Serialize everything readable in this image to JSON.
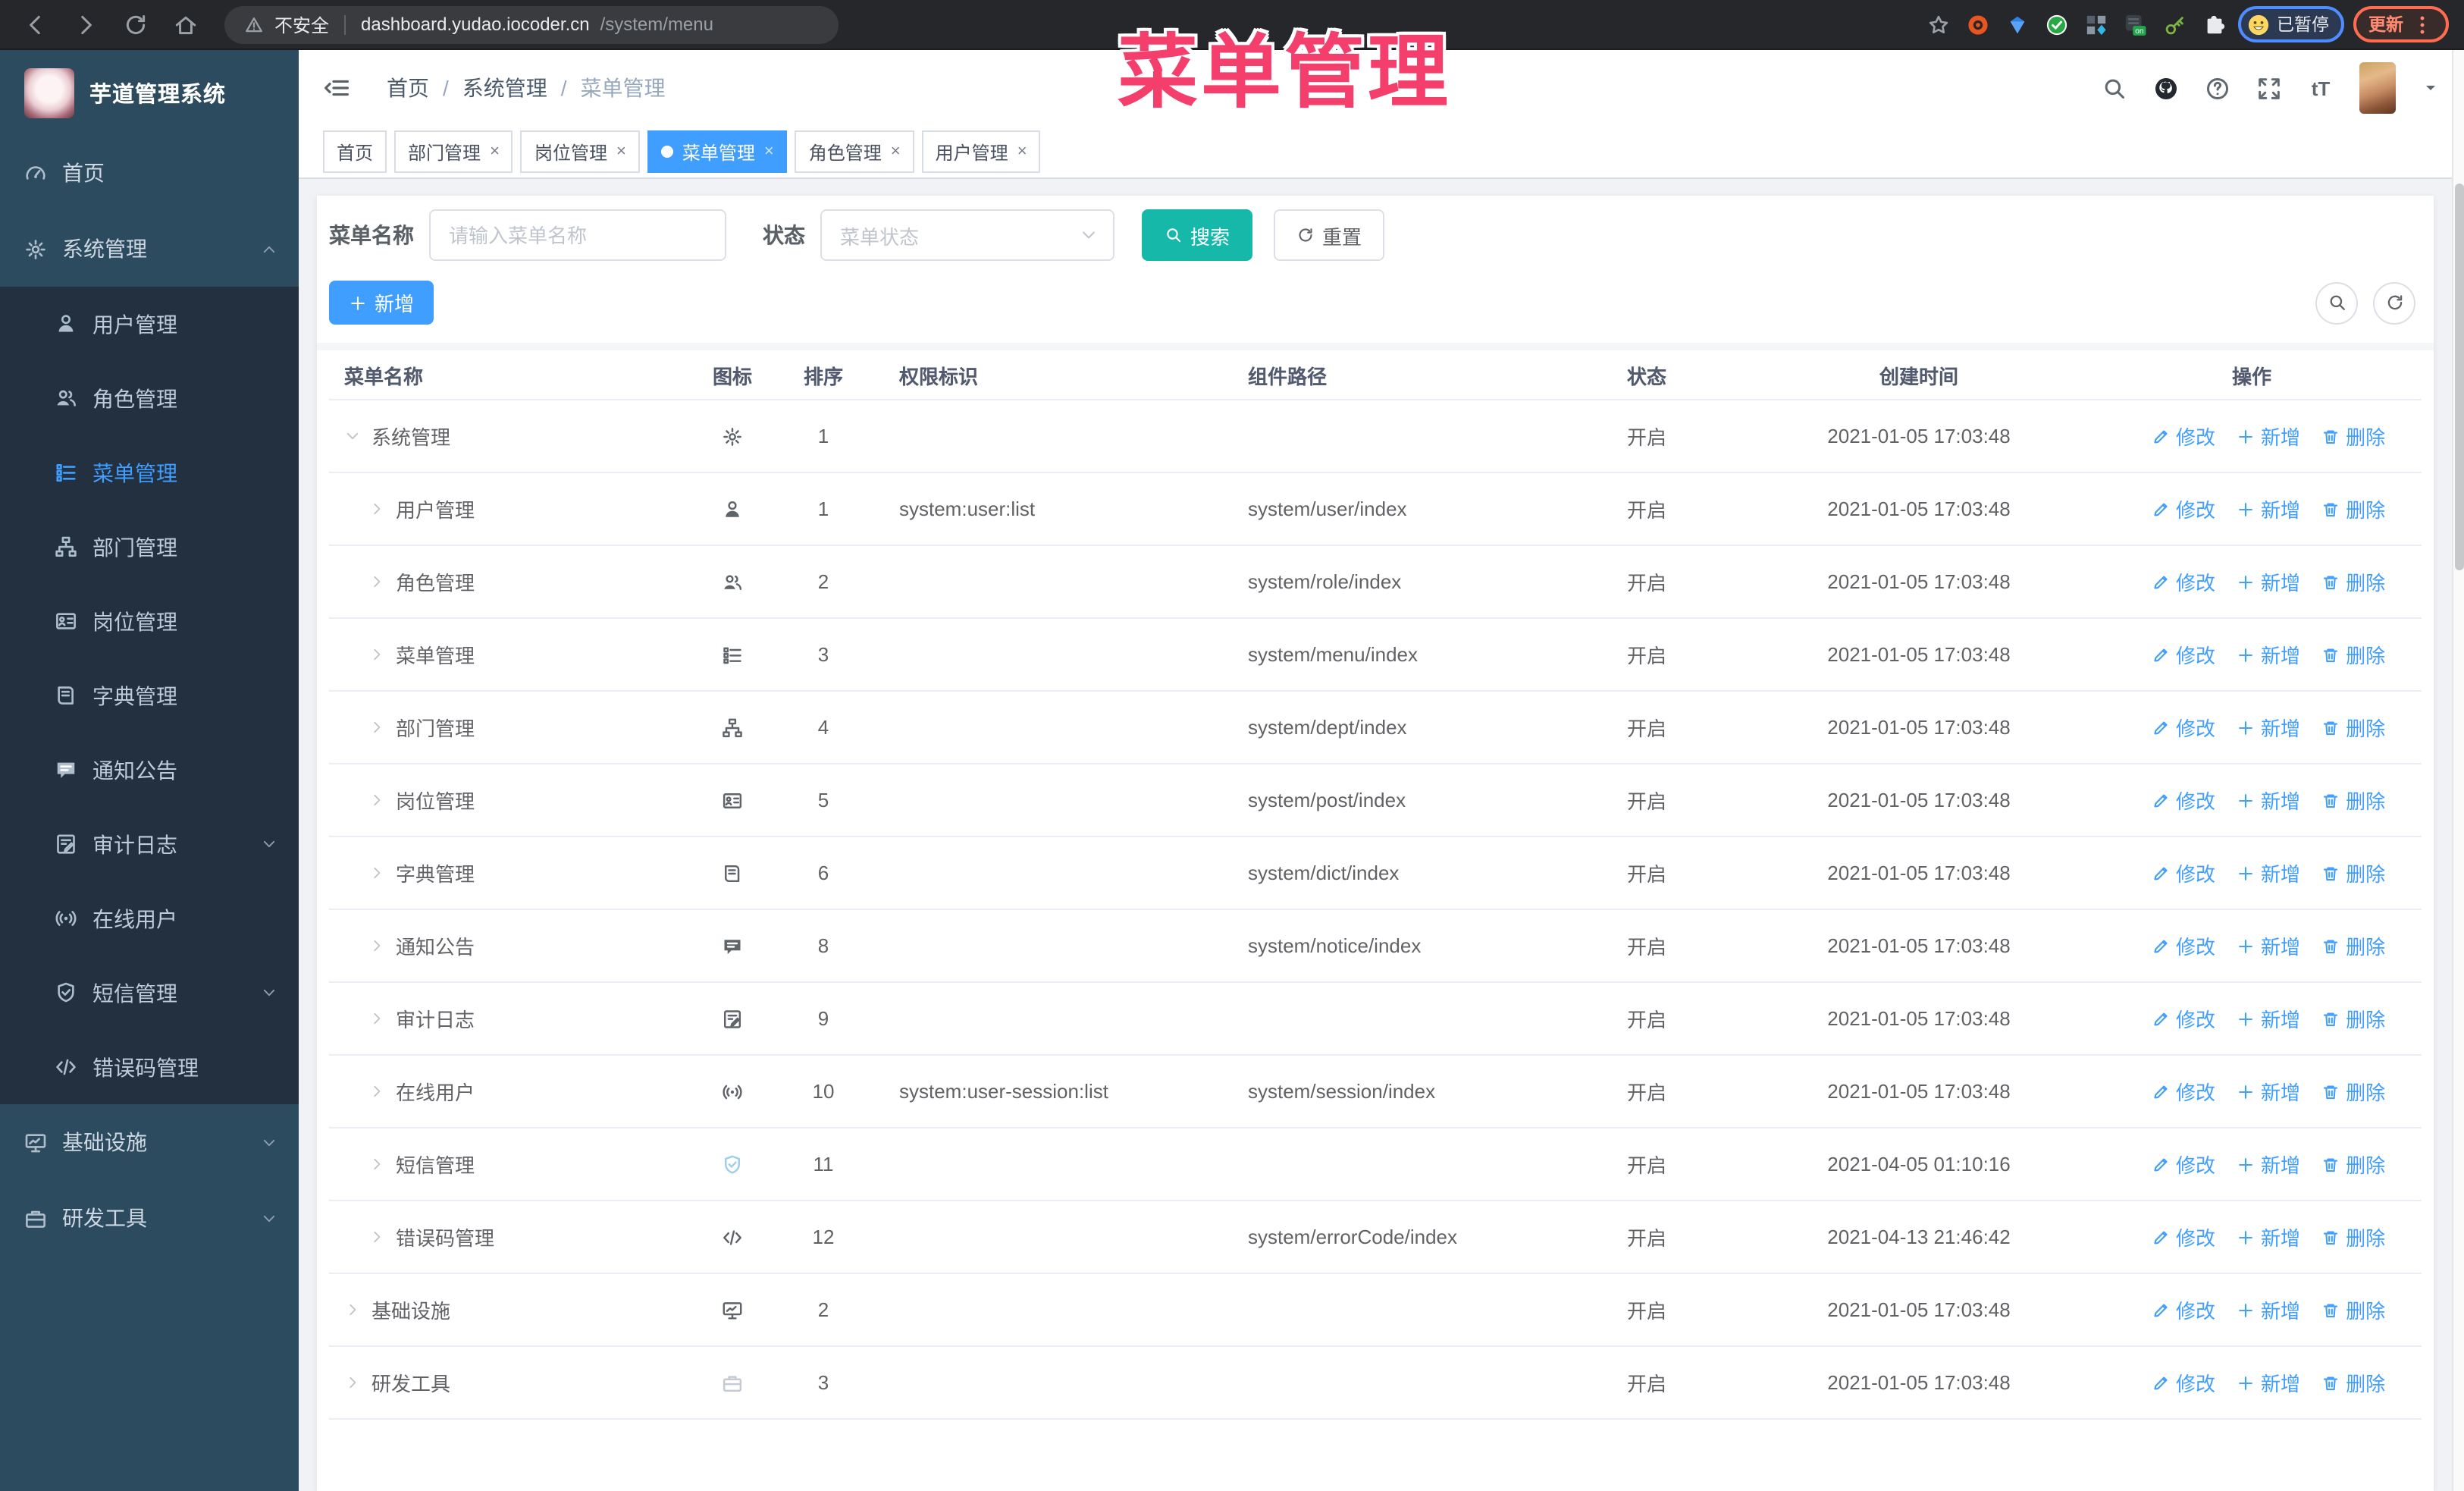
{
  "browser": {
    "security_label": "不安全",
    "url_host": "dashboard.yudao.iocoder.cn",
    "url_path": "/system/menu",
    "paused_label": "已暂停",
    "update_label": "更新",
    "extension_icons": [
      "ubuntu-circle-icon",
      "gem-icon",
      "check-shield-icon",
      "grid-diamond-icon",
      "on-badge-icon",
      "key-icon",
      "puzzle-icon"
    ]
  },
  "overlay_title": "菜单管理",
  "app_header": {
    "breadcrumb": [
      "首页",
      "系统管理",
      "菜单管理"
    ]
  },
  "sidebar": {
    "app_title": "芋道管理系统",
    "items": [
      {
        "label": "首页",
        "icon": "dashboard-icon",
        "level": 0
      },
      {
        "label": "系统管理",
        "icon": "gear-icon",
        "level": 0,
        "arrow": "up"
      },
      {
        "label": "用户管理",
        "icon": "user-icon",
        "level": 1
      },
      {
        "label": "角色管理",
        "icon": "users-icon",
        "level": 1
      },
      {
        "label": "菜单管理",
        "icon": "menu-list-icon",
        "level": 1,
        "active": true
      },
      {
        "label": "部门管理",
        "icon": "org-tree-icon",
        "level": 1
      },
      {
        "label": "岗位管理",
        "icon": "badge-icon",
        "level": 1
      },
      {
        "label": "字典管理",
        "icon": "dict-icon",
        "level": 1
      },
      {
        "label": "通知公告",
        "icon": "notice-icon",
        "level": 1
      },
      {
        "label": "审计日志",
        "icon": "log-icon",
        "level": 1,
        "arrow": "down"
      },
      {
        "label": "在线用户",
        "icon": "online-icon",
        "level": 1
      },
      {
        "label": "短信管理",
        "icon": "sms-shield-icon",
        "level": 1,
        "arrow": "down"
      },
      {
        "label": "错误码管理",
        "icon": "code-icon",
        "level": 1
      },
      {
        "label": "基础设施",
        "icon": "infra-icon",
        "level": 0,
        "arrow": "down"
      },
      {
        "label": "研发工具",
        "icon": "tool-icon",
        "level": 0,
        "arrow": "down"
      }
    ]
  },
  "tabs": [
    {
      "label": "首页",
      "closable": false,
      "active": false
    },
    {
      "label": "部门管理",
      "closable": true,
      "active": false
    },
    {
      "label": "岗位管理",
      "closable": true,
      "active": false
    },
    {
      "label": "菜单管理",
      "closable": true,
      "active": true
    },
    {
      "label": "角色管理",
      "closable": true,
      "active": false
    },
    {
      "label": "用户管理",
      "closable": true,
      "active": false
    }
  ],
  "search": {
    "name_label": "菜单名称",
    "name_placeholder": "请输入菜单名称",
    "status_label": "状态",
    "status_placeholder": "菜单状态",
    "search_label": "搜索",
    "reset_label": "重置"
  },
  "toolbar": {
    "add_label": "新增"
  },
  "table": {
    "columns": [
      "菜单名称",
      "图标",
      "排序",
      "权限标识",
      "组件路径",
      "状态",
      "创建时间",
      "操作"
    ],
    "actions": {
      "edit": "修改",
      "add": "新增",
      "delete": "删除"
    },
    "rows": [
      {
        "name": "系统管理",
        "icon": "gear-icon",
        "level": 0,
        "expanded": true,
        "sort": "1",
        "perm": "",
        "path": "",
        "status": "开启",
        "time": "2021-01-05 17:03:48"
      },
      {
        "name": "用户管理",
        "icon": "user-icon",
        "level": 1,
        "sort": "1",
        "perm": "system:user:list",
        "path": "system/user/index",
        "status": "开启",
        "time": "2021-01-05 17:03:48"
      },
      {
        "name": "角色管理",
        "icon": "users-icon",
        "level": 1,
        "sort": "2",
        "perm": "",
        "path": "system/role/index",
        "status": "开启",
        "time": "2021-01-05 17:03:48"
      },
      {
        "name": "菜单管理",
        "icon": "menu-list-icon",
        "level": 1,
        "sort": "3",
        "perm": "",
        "path": "system/menu/index",
        "status": "开启",
        "time": "2021-01-05 17:03:48"
      },
      {
        "name": "部门管理",
        "icon": "org-tree-icon",
        "level": 1,
        "sort": "4",
        "perm": "",
        "path": "system/dept/index",
        "status": "开启",
        "time": "2021-01-05 17:03:48"
      },
      {
        "name": "岗位管理",
        "icon": "badge-icon",
        "level": 1,
        "sort": "5",
        "perm": "",
        "path": "system/post/index",
        "status": "开启",
        "time": "2021-01-05 17:03:48"
      },
      {
        "name": "字典管理",
        "icon": "dict-icon",
        "level": 1,
        "sort": "6",
        "perm": "",
        "path": "system/dict/index",
        "status": "开启",
        "time": "2021-01-05 17:03:48"
      },
      {
        "name": "通知公告",
        "icon": "notice-icon",
        "level": 1,
        "sort": "8",
        "perm": "",
        "path": "system/notice/index",
        "status": "开启",
        "time": "2021-01-05 17:03:48"
      },
      {
        "name": "审计日志",
        "icon": "log-icon",
        "level": 1,
        "sort": "9",
        "perm": "",
        "path": "",
        "status": "开启",
        "time": "2021-01-05 17:03:48"
      },
      {
        "name": "在线用户",
        "icon": "online-icon",
        "level": 1,
        "sort": "10",
        "perm": "system:user-session:list",
        "path": "system/session/index",
        "status": "开启",
        "time": "2021-01-05 17:03:48"
      },
      {
        "name": "短信管理",
        "icon": "sms-shield-icon",
        "tone": "light",
        "level": 1,
        "sort": "11",
        "perm": "",
        "path": "",
        "status": "开启",
        "time": "2021-04-05 01:10:16"
      },
      {
        "name": "错误码管理",
        "icon": "code-icon",
        "level": 1,
        "sort": "12",
        "perm": "",
        "path": "system/errorCode/index",
        "status": "开启",
        "time": "2021-04-13 21:46:42"
      },
      {
        "name": "基础设施",
        "icon": "infra-icon",
        "level": 0,
        "sort": "2",
        "perm": "",
        "path": "",
        "status": "开启",
        "time": "2021-01-05 17:03:48"
      },
      {
        "name": "研发工具",
        "icon": "tool-icon",
        "tone": "muted",
        "level": 0,
        "sort": "3",
        "perm": "",
        "path": "",
        "status": "开启",
        "time": "2021-01-05 17:03:48"
      }
    ]
  },
  "colors": {
    "primary": "#409eff",
    "search_teal": "#16b8aa",
    "overlay_pink": "#f43f6d",
    "sidebar_bg": "#2d4b5e",
    "submenu_bg": "#22303f"
  }
}
